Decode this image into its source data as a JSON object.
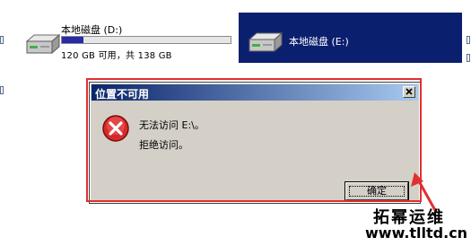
{
  "drives": {
    "d": {
      "label": "本地磁盘 (D:)",
      "capacity": "120 GB 可用，共 138 GB",
      "used_fraction": 0.13
    },
    "e": {
      "label": "本地磁盘 (E:)",
      "selected": true
    }
  },
  "dialog": {
    "title": "位置不可用",
    "message_line1": "无法访问 E:\\。",
    "message_line2": "拒绝访问。",
    "ok_label": "确定",
    "close_glyph": "×"
  },
  "icons": {
    "drive": "hard-drive-icon",
    "error": "error-icon",
    "close": "close-icon"
  },
  "colors": {
    "selection": "#0b1f6f",
    "titlebar_start": "#0a246a",
    "titlebar_end": "#a6caf0",
    "annotation": "#e03030",
    "usage_fill": "#2a2aa8"
  },
  "watermark": {
    "logo": "拓幂运维",
    "url": "www.tlltd.cn"
  }
}
